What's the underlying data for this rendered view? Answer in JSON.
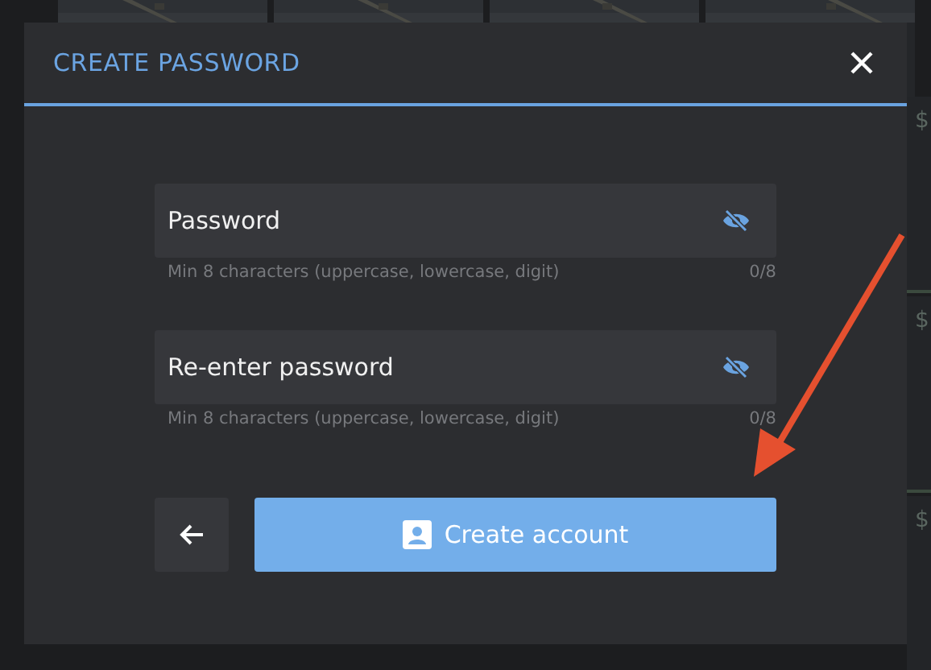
{
  "background": {
    "side_prices": [
      "$",
      "$",
      "$"
    ]
  },
  "dialog": {
    "title": "CREATE PASSWORD",
    "fields": [
      {
        "placeholder": "Password",
        "hint": "Min 8 characters (uppercase, lowercase, digit)",
        "counter": "0/8"
      },
      {
        "placeholder": "Re-enter password",
        "hint": "Min 8 characters (uppercase, lowercase, digit)",
        "counter": "0/8"
      }
    ],
    "primary_button": "Create account"
  }
}
